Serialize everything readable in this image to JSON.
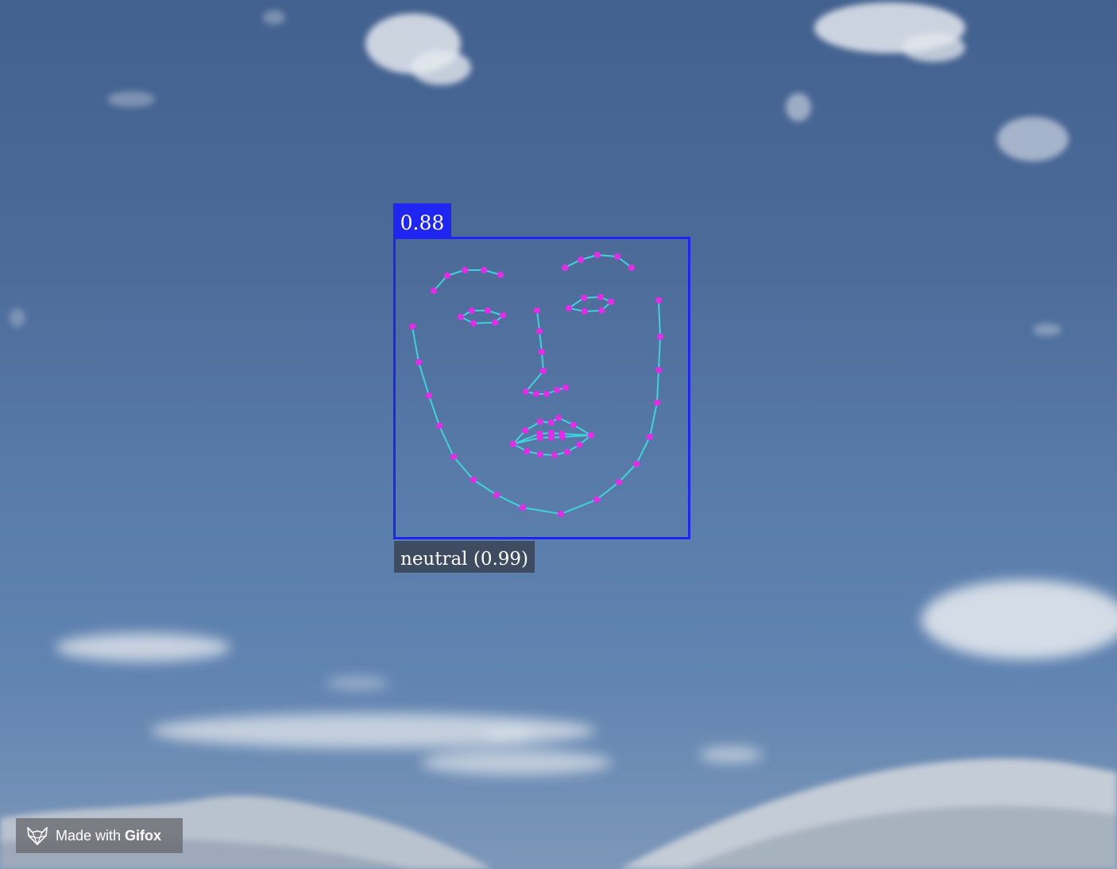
{
  "detection": {
    "score": "0.88",
    "expression_label": "neutral (0.99)"
  },
  "landmark_style": {
    "line_color": "#3fd2dd",
    "point_color": "#e62ae8",
    "box_color": "#1f26f2"
  },
  "watermark": {
    "prefix": "Made with",
    "brand": "Gifox",
    "icon": "fox-icon"
  }
}
